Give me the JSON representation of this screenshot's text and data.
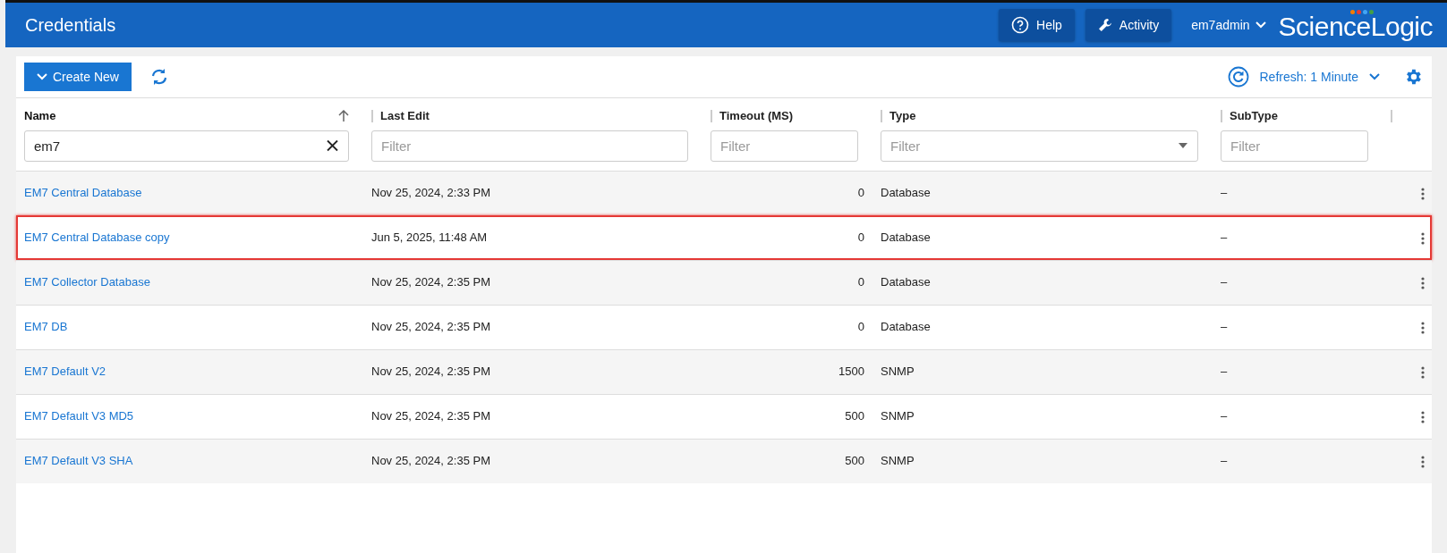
{
  "header": {
    "title": "Credentials",
    "help": "Help",
    "activity": "Activity",
    "user": "em7admin",
    "logo": "ScienceLogic"
  },
  "toolbar": {
    "create_new": "Create New",
    "refresh": "Refresh: 1 Minute"
  },
  "table": {
    "columns": [
      {
        "label": "Name",
        "sorted": true,
        "filter": {
          "kind": "text",
          "value": "em7"
        }
      },
      {
        "label": "Last Edit",
        "sorted": false,
        "filter": {
          "kind": "text",
          "placeholder": "Filter"
        }
      },
      {
        "label": "Timeout (MS)",
        "sorted": false,
        "filter": {
          "kind": "text",
          "placeholder": "Filter"
        }
      },
      {
        "label": "Type",
        "sorted": false,
        "filter": {
          "kind": "select",
          "placeholder": "Filter"
        }
      },
      {
        "label": "SubType",
        "sorted": false,
        "filter": {
          "kind": "text",
          "placeholder": "Filter"
        }
      }
    ],
    "rows": [
      {
        "name": "EM7 Central Database",
        "last_edit": "Nov 25, 2024, 2:33 PM",
        "timeout": "0",
        "type": "Database",
        "subtype": "–",
        "highlighted": false
      },
      {
        "name": "EM7 Central Database copy",
        "last_edit": "Jun 5, 2025, 11:48 AM",
        "timeout": "0",
        "type": "Database",
        "subtype": "–",
        "highlighted": true
      },
      {
        "name": "EM7 Collector Database",
        "last_edit": "Nov 25, 2024, 2:35 PM",
        "timeout": "0",
        "type": "Database",
        "subtype": "–",
        "highlighted": false
      },
      {
        "name": "EM7 DB",
        "last_edit": "Nov 25, 2024, 2:35 PM",
        "timeout": "0",
        "type": "Database",
        "subtype": "–",
        "highlighted": false
      },
      {
        "name": "EM7 Default V2",
        "last_edit": "Nov 25, 2024, 2:35 PM",
        "timeout": "1500",
        "type": "SNMP",
        "subtype": "–",
        "highlighted": false
      },
      {
        "name": "EM7 Default V3 MD5",
        "last_edit": "Nov 25, 2024, 2:35 PM",
        "timeout": "500",
        "type": "SNMP",
        "subtype": "–",
        "highlighted": false
      },
      {
        "name": "EM7 Default V3 SHA",
        "last_edit": "Nov 25, 2024, 2:35 PM",
        "timeout": "500",
        "type": "SNMP",
        "subtype": "–",
        "highlighted": false
      }
    ]
  }
}
